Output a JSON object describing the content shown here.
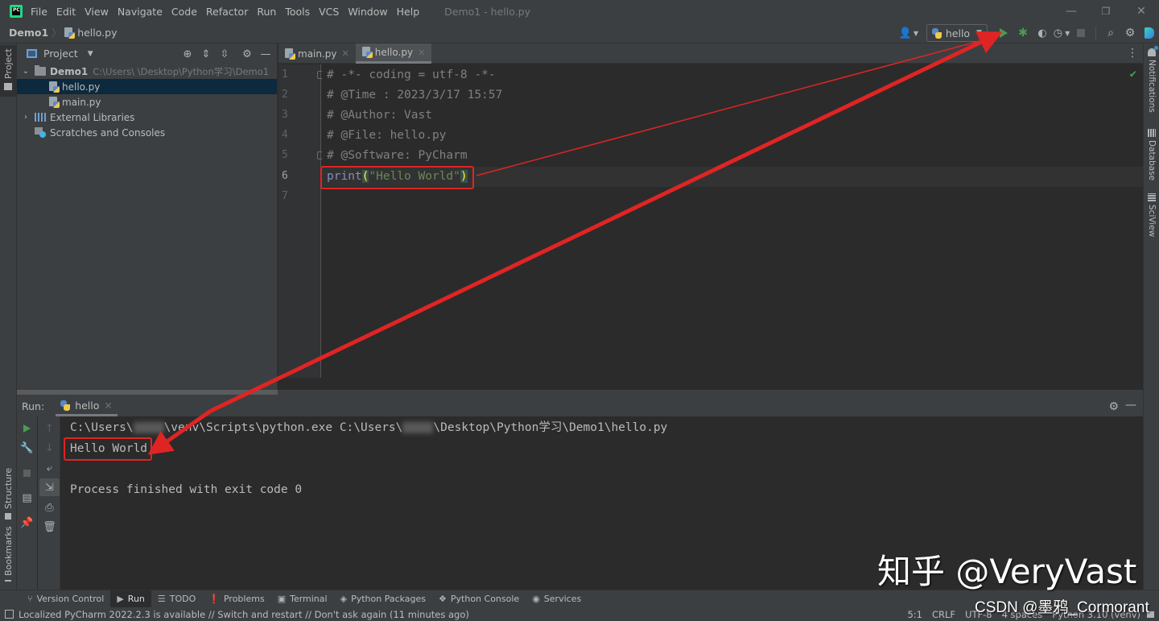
{
  "title_bar": {
    "menu": [
      "File",
      "Edit",
      "View",
      "Navigate",
      "Code",
      "Refactor",
      "Run",
      "Tools",
      "VCS",
      "Window",
      "Help"
    ],
    "window_title": "Demo1 - hello.py",
    "controls": {
      "minimize": "—",
      "restore": "❐",
      "close": "✕"
    }
  },
  "nav_bar": {
    "breadcrumb": [
      {
        "label": "Demo1"
      },
      {
        "label": "hello.py",
        "icon": "python-file-icon"
      }
    ],
    "run_config": "hello",
    "toolbar_icons": [
      "account-icon",
      "run-icon",
      "debug-icon",
      "coverage-icon",
      "profile-icon",
      "stop-icon",
      "search-icon",
      "settings-icon",
      "toolbox-icon"
    ]
  },
  "left_stripe": {
    "tabs": [
      "Project",
      "Structure",
      "Bookmarks"
    ]
  },
  "project_panel": {
    "title": "Project",
    "tree": [
      {
        "label": "Demo1",
        "path": "C:\\Users\\        \\Desktop\\Python学习\\Demo1",
        "type": "folder",
        "expanded": true,
        "level": 0
      },
      {
        "label": "hello.py",
        "type": "python-file",
        "level": 1,
        "selected": true
      },
      {
        "label": "main.py",
        "type": "python-file",
        "level": 1
      },
      {
        "label": "External Libraries",
        "type": "library",
        "expanded": false,
        "level": 0
      },
      {
        "label": "Scratches and Consoles",
        "type": "scratch",
        "level": 0
      }
    ]
  },
  "editor": {
    "tabs": [
      {
        "label": "main.py",
        "active": false
      },
      {
        "label": "hello.py",
        "active": true
      }
    ],
    "lines": [
      {
        "no": "1",
        "text": "# -*- coding = utf-8 -*-"
      },
      {
        "no": "2",
        "text": "# @Time : 2023/3/17 15:57"
      },
      {
        "no": "3",
        "text": "# @Author: Vast"
      },
      {
        "no": "4",
        "text": "# @File: hello.py"
      },
      {
        "no": "5",
        "text": "# @Software: PyCharm"
      },
      {
        "no": "6",
        "fn": "print",
        "open": "(",
        "str": "\"Hello World\"",
        "close": ")"
      },
      {
        "no": "7",
        "text": ""
      }
    ],
    "inspection_status": "ok"
  },
  "right_stripe": {
    "tabs": [
      "Notifications",
      "Database",
      "SciView"
    ]
  },
  "run_panel": {
    "label": "Run:",
    "tab": "hello",
    "console": {
      "command_prefix": "C:\\Users\\",
      "command_mid": "\\venv\\Scripts\\python.exe C:\\Users\\",
      "command_suffix": "\\Desktop\\Python学习\\Demo1\\hello.py",
      "output": "Hello World",
      "exit_message": "Process finished with exit code 0"
    }
  },
  "tool_tabs": [
    {
      "label": "Version Control",
      "icon": "⑂"
    },
    {
      "label": "Run",
      "icon": "▶",
      "active": true
    },
    {
      "label": "TODO",
      "icon": "☰"
    },
    {
      "label": "Problems",
      "icon": "❗"
    },
    {
      "label": "Terminal",
      "icon": "▣"
    },
    {
      "label": "Python Packages",
      "icon": "◈"
    },
    {
      "label": "Python Console",
      "icon": "❖"
    },
    {
      "label": "Services",
      "icon": "◉"
    }
  ],
  "status_bar": {
    "message": "Localized PyCharm 2022.2.3 is available // Switch and restart // Don't ask again (11 minutes ago)",
    "position": "5:1",
    "line_separator": "CRLF",
    "encoding": "UTF-8",
    "indent": "4 spaces",
    "interpreter": "Python 3.10 (venv)"
  },
  "watermarks": {
    "zhihu": "知乎 @VeryVast",
    "csdn": "CSDN @墨鸦_Cormorant"
  },
  "annotation_color": "#e02424"
}
